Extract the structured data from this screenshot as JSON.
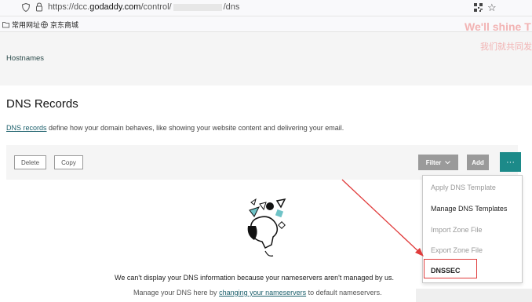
{
  "browser": {
    "url_prefix": "https://dcc.",
    "url_domain": "godaddy.com",
    "url_path": "/control/",
    "url_suffix": "/dns"
  },
  "bookmarks": [
    {
      "label": "常用网址",
      "icon": "folder-icon"
    },
    {
      "label": "京东商城",
      "icon": "globe-icon"
    }
  ],
  "watermark": {
    "line1": "We'll shine T",
    "line2": "我们就共同发"
  },
  "nav": {
    "hostnames": "Hostnames"
  },
  "page": {
    "title": "DNS Records",
    "desc_link": "DNS records",
    "desc_rest": " define how your domain behaves, like showing your website content and delivering your email."
  },
  "toolbar": {
    "delete": "Delete",
    "copy": "Copy",
    "filter": "Filter",
    "add": "Add",
    "more": "···"
  },
  "menu": {
    "items": [
      {
        "label": "Apply DNS Template",
        "state": "disabled"
      },
      {
        "label": "Manage DNS Templates",
        "state": "enabled"
      },
      {
        "label": "Import Zone File",
        "state": "disabled"
      },
      {
        "label": "Export Zone File",
        "state": "disabled"
      },
      {
        "label": "DNSSEC",
        "state": "highlighted"
      }
    ]
  },
  "message": {
    "line1": "We can't display your DNS information because your nameservers aren't managed by us.",
    "line2_pre": "Manage your DNS here by ",
    "line2_link": "changing your nameservers",
    "line2_post": " to default nameservers."
  },
  "colors": {
    "accent": "#1c8a89",
    "annotation": "#e03b3b"
  }
}
